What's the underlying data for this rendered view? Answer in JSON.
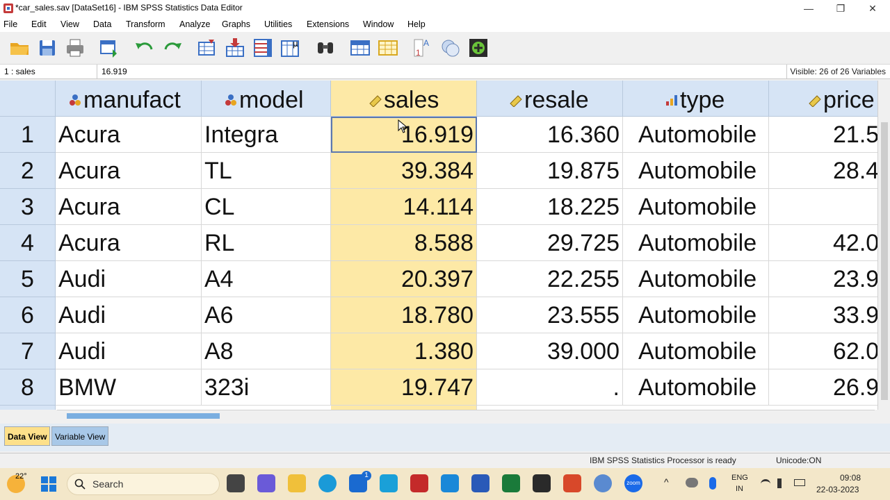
{
  "window": {
    "title": "*car_sales.sav [DataSet16] - IBM SPSS Statistics Data Editor",
    "minimize_glyph": "—",
    "restore_glyph": "❐",
    "close_glyph": "✕"
  },
  "menu": [
    "File",
    "Edit",
    "View",
    "Data",
    "Transform",
    "Analyze",
    "Graphs",
    "Utilities",
    "Extensions",
    "Window",
    "Help"
  ],
  "toolbar_icons": [
    "open-folder-icon",
    "save-icon",
    "print-icon",
    "recall-dialog-icon",
    "undo-icon",
    "redo-icon",
    "go-to-case-icon",
    "go-to-variable-icon",
    "variables-icon",
    "run-descriptive-statistics-icon",
    "find-icon",
    "insert-cases-icon",
    "insert-variable-icon",
    "split-file-icon",
    "weight-cases-icon",
    "select-cases-icon",
    "value-labels-icon"
  ],
  "cellbar": {
    "ref": "1 : sales",
    "value": "16.919",
    "visible": "Visible: 26 of 26 Variables"
  },
  "columns": [
    {
      "name": "manufact",
      "icon": "nominal-icon"
    },
    {
      "name": "model",
      "icon": "nominal-icon"
    },
    {
      "name": "sales",
      "icon": "scale-icon"
    },
    {
      "name": "resale",
      "icon": "scale-icon"
    },
    {
      "name": "type",
      "icon": "ordinal-icon"
    },
    {
      "name": "price",
      "icon": "scale-icon"
    }
  ],
  "rows": [
    {
      "n": "1",
      "manufact": "Acura",
      "model": "Integra",
      "sales": "16.919",
      "resale": "16.360",
      "type": "Automobile",
      "price": "21.5"
    },
    {
      "n": "2",
      "manufact": "Acura",
      "model": "TL",
      "sales": "39.384",
      "resale": "19.875",
      "type": "Automobile",
      "price": "28.4"
    },
    {
      "n": "3",
      "manufact": "Acura",
      "model": "CL",
      "sales": "14.114",
      "resale": "18.225",
      "type": "Automobile",
      "price": ""
    },
    {
      "n": "4",
      "manufact": "Acura",
      "model": "RL",
      "sales": "8.588",
      "resale": "29.725",
      "type": "Automobile",
      "price": "42.0"
    },
    {
      "n": "5",
      "manufact": "Audi",
      "model": "A4",
      "sales": "20.397",
      "resale": "22.255",
      "type": "Automobile",
      "price": "23.9"
    },
    {
      "n": "6",
      "manufact": "Audi",
      "model": "A6",
      "sales": "18.780",
      "resale": "23.555",
      "type": "Automobile",
      "price": "33.9"
    },
    {
      "n": "7",
      "manufact": "Audi",
      "model": "A8",
      "sales": "1.380",
      "resale": "39.000",
      "type": "Automobile",
      "price": "62.0"
    },
    {
      "n": "8",
      "manufact": "BMW",
      "model": "323i",
      "sales": "19.747",
      "resale": ".",
      "type": "Automobile",
      "price": "26.9"
    }
  ],
  "tabs": [
    "Data View",
    "Variable View"
  ],
  "status": {
    "processor": "IBM SPSS Statistics Processor is ready",
    "unicode": "Unicode:ON"
  },
  "taskbar": {
    "weather": "22°",
    "search": "Search",
    "lang_top": "ENG",
    "lang_bottom": "IN",
    "time": "09:08",
    "date": "22-03-2023",
    "badge": "1",
    "zoom_label": "zoom",
    "up_glyph": "^"
  },
  "colors": {
    "accent_selected": "#fde9a6",
    "header_blue": "#d6e4f5",
    "taskbar": "#f3e7c9"
  }
}
